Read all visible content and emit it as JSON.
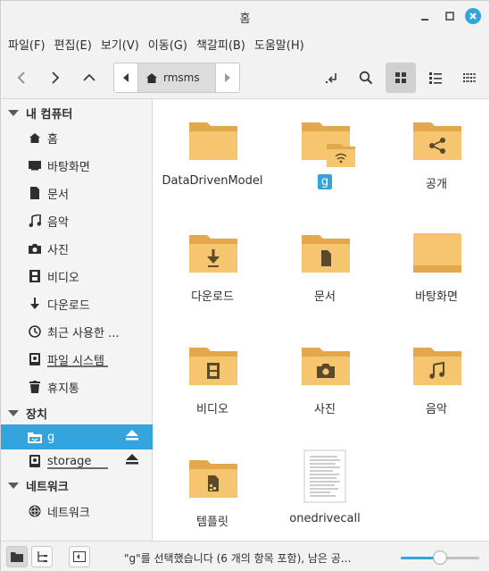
{
  "window": {
    "title": "홈"
  },
  "menu": [
    "파일(F)",
    "편집(E)",
    "보기(V)",
    "이동(G)",
    "책갈피(B)",
    "도움말(H)"
  ],
  "toolbar": {
    "path_crumb": "rmsms"
  },
  "sidebar": {
    "sections": {
      "computer": "내 컴퓨터",
      "devices": "장치",
      "network": "네트워크"
    },
    "computer_items": [
      {
        "label": "홈",
        "icon": "home-icon"
      },
      {
        "label": "바탕화면",
        "icon": "desktop-icon"
      },
      {
        "label": "문서",
        "icon": "document-icon"
      },
      {
        "label": "음악",
        "icon": "music-icon"
      },
      {
        "label": "사진",
        "icon": "camera-icon"
      },
      {
        "label": "비디오",
        "icon": "film-icon"
      },
      {
        "label": "다운로드",
        "icon": "download-icon"
      },
      {
        "label": "최근 사용한 ...",
        "icon": "clock-icon"
      },
      {
        "label": "파일 시스템",
        "icon": "drive-icon",
        "usage": 0.55
      },
      {
        "label": "휴지통",
        "icon": "trash-icon"
      }
    ],
    "device_items": [
      {
        "label": "g",
        "icon": "folder-icon",
        "selected": true
      },
      {
        "label": "storage",
        "icon": "drive-icon",
        "usage": 0.62
      }
    ],
    "network_items": [
      {
        "label": "네트워크",
        "icon": "network-icon"
      }
    ]
  },
  "files": [
    {
      "name": "DataDrivenModel",
      "type": "folder",
      "emblem": ""
    },
    {
      "name": "g",
      "type": "folder",
      "emblem": "wifi-icon",
      "selected": true
    },
    {
      "name": "공개",
      "type": "folder",
      "emblem": "share-icon"
    },
    {
      "name": "다운로드",
      "type": "folder",
      "emblem": "download-icon"
    },
    {
      "name": "문서",
      "type": "folder",
      "emblem": "document-icon"
    },
    {
      "name": "바탕화면",
      "type": "folder",
      "emblem": "desktop-folder"
    },
    {
      "name": "비디오",
      "type": "folder",
      "emblem": "film-icon"
    },
    {
      "name": "사진",
      "type": "folder",
      "emblem": "camera-icon"
    },
    {
      "name": "음악",
      "type": "folder",
      "emblem": "music-icon"
    },
    {
      "name": "템플릿",
      "type": "folder",
      "emblem": "template-icon"
    },
    {
      "name": "onedrivecall",
      "type": "text-file",
      "emblem": ""
    }
  ],
  "statusbar": {
    "text": "\"g\"를 선택했습니다 (6 개의 항목 포함), 남은 공...",
    "zoom": 0.5
  },
  "colors": {
    "accent": "#35a4dc",
    "folder": "#f6c56f",
    "folder_dark": "#e3a74c"
  }
}
